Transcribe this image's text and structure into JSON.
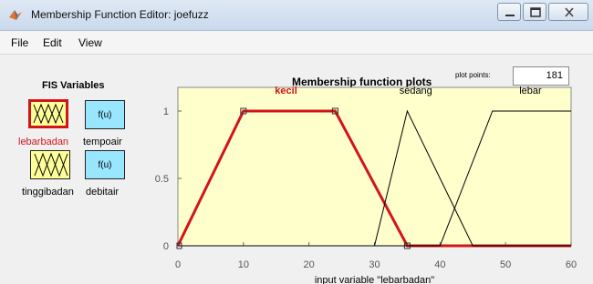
{
  "window": {
    "title": "Membership Function Editor: joefuzz",
    "minimize_icon": "minimize-icon",
    "maximize_icon": "maximize-icon",
    "close_icon": "close-icon"
  },
  "menu": [
    "File",
    "Edit",
    "View"
  ],
  "fis_panel": {
    "heading": "FIS Variables",
    "inputs": [
      {
        "name": "lebarbadan",
        "selected": true
      },
      {
        "name": "tinggibadan",
        "selected": false
      }
    ],
    "outputs": [
      {
        "name": "tempoair",
        "glyph": "f(u)"
      },
      {
        "name": "debitair",
        "glyph": "f(u)"
      }
    ]
  },
  "plot": {
    "title": "Membership function plots",
    "plot_points_label": "plot points:",
    "plot_points_value": "181",
    "background": "#ffffcc",
    "highlight_color": "#d2141a"
  },
  "chart_data": {
    "type": "line",
    "xlabel": "input variable \"lebarbadan\"",
    "ylabel": "",
    "xlim": [
      0,
      60
    ],
    "ylim": [
      0,
      1
    ],
    "x_ticks": [
      "0",
      "10",
      "20",
      "30",
      "40",
      "50",
      "60"
    ],
    "y_ticks": [
      "0",
      "0.5",
      "1"
    ],
    "series": [
      {
        "name": "kecil",
        "selected": true,
        "x": [
          0,
          10,
          24,
          35,
          60
        ],
        "y": [
          0,
          1,
          1,
          0,
          0
        ]
      },
      {
        "name": "sedang",
        "selected": false,
        "x": [
          0,
          30,
          35,
          45,
          60
        ],
        "y": [
          0,
          0,
          1,
          0,
          0
        ]
      },
      {
        "name": "lebar",
        "selected": false,
        "x": [
          0,
          40,
          48,
          60
        ],
        "y": [
          0,
          0,
          1,
          1
        ]
      }
    ]
  }
}
